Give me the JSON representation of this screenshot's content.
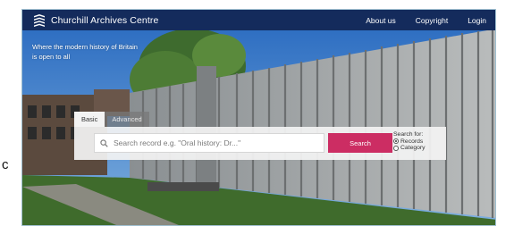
{
  "edge_fragment": "c",
  "header": {
    "brand_name": "Churchill Archives Centre",
    "nav": [
      "About us",
      "Copyright",
      "Login"
    ]
  },
  "hero": {
    "tagline": "Where the modern history of Britain is open to all"
  },
  "search": {
    "tabs": [
      {
        "label": "Basic",
        "active": true
      },
      {
        "label": "Advanced",
        "active": false
      }
    ],
    "placeholder": "Search record e.g. \"Oral history: Dr...\"",
    "button_label": "Search",
    "search_for_label": "Search for:",
    "options": [
      {
        "label": "Records",
        "selected": true
      },
      {
        "label": "Category",
        "selected": false
      }
    ]
  },
  "colors": {
    "header_bg": "#142b5c",
    "accent": "#cc2d63"
  }
}
